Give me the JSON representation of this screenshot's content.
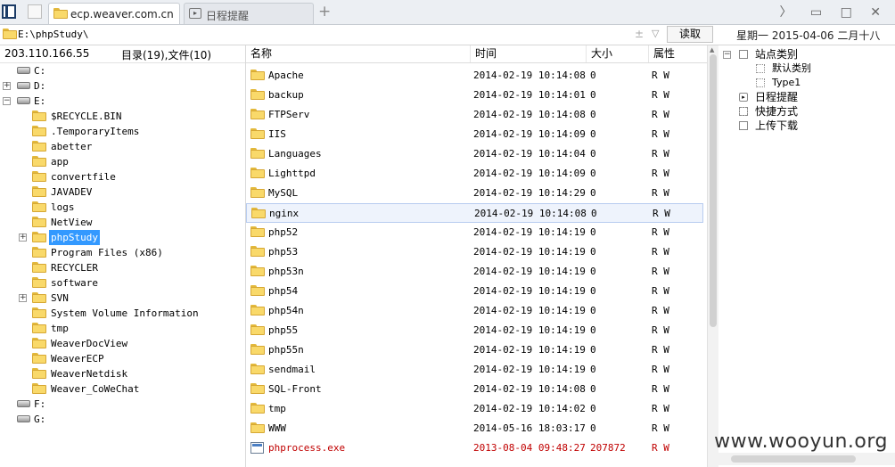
{
  "tabs": [
    {
      "label": "ecp.weaver.com.cn",
      "active": true
    },
    {
      "label": "日程提醒",
      "active": false
    }
  ],
  "tab_new": "+",
  "window_controls": "〉 ▭ □ ✕",
  "address": {
    "path": "E:\\phpStudy\\",
    "plusminus": "± ",
    "read_button": "读取"
  },
  "date_line": "星期一  2015-04-06  二月十八",
  "left_panel": {
    "ip": "203.110.166.55",
    "dir_count": "目录(19),文件(10)",
    "tree": [
      {
        "label": "C:",
        "type": "drive",
        "depth": 0,
        "expander": ""
      },
      {
        "label": "D:",
        "type": "drive",
        "depth": 0,
        "expander": "+"
      },
      {
        "label": "E:",
        "type": "drive",
        "depth": 0,
        "expander": "−"
      },
      {
        "label": "$RECYCLE.BIN",
        "type": "folder",
        "depth": 1,
        "expander": ""
      },
      {
        "label": ".TemporaryItems",
        "type": "folder",
        "depth": 1,
        "expander": ""
      },
      {
        "label": "abetter",
        "type": "folder",
        "depth": 1,
        "expander": ""
      },
      {
        "label": "app",
        "type": "folder",
        "depth": 1,
        "expander": ""
      },
      {
        "label": "convertfile",
        "type": "folder",
        "depth": 1,
        "expander": ""
      },
      {
        "label": "JAVADEV",
        "type": "folder",
        "depth": 1,
        "expander": ""
      },
      {
        "label": "logs",
        "type": "folder",
        "depth": 1,
        "expander": ""
      },
      {
        "label": "NetView",
        "type": "folder",
        "depth": 1,
        "expander": ""
      },
      {
        "label": "phpStudy",
        "type": "folder",
        "depth": 1,
        "expander": "+",
        "selected": true
      },
      {
        "label": "Program Files (x86)",
        "type": "folder",
        "depth": 1,
        "expander": ""
      },
      {
        "label": "RECYCLER",
        "type": "folder",
        "depth": 1,
        "expander": ""
      },
      {
        "label": "software",
        "type": "folder",
        "depth": 1,
        "expander": ""
      },
      {
        "label": "SVN",
        "type": "folder",
        "depth": 1,
        "expander": "+"
      },
      {
        "label": "System Volume Information",
        "type": "folder",
        "depth": 1,
        "expander": ""
      },
      {
        "label": "tmp",
        "type": "folder",
        "depth": 1,
        "expander": ""
      },
      {
        "label": "WeaverDocView",
        "type": "folder",
        "depth": 1,
        "expander": ""
      },
      {
        "label": "WeaverECP",
        "type": "folder",
        "depth": 1,
        "expander": ""
      },
      {
        "label": "WeaverNetdisk",
        "type": "folder",
        "depth": 1,
        "expander": ""
      },
      {
        "label": "Weaver_CoWeChat",
        "type": "folder",
        "depth": 1,
        "expander": ""
      },
      {
        "label": "F:",
        "type": "drive",
        "depth": 0,
        "expander": ""
      },
      {
        "label": "G:",
        "type": "drive",
        "depth": 0,
        "expander": ""
      }
    ]
  },
  "file_list": {
    "headers": {
      "name": "名称",
      "time": "时间",
      "size": "大小",
      "attr": "属性"
    },
    "rows": [
      {
        "name": "Apache",
        "time": "2014-02-19 10:14:08",
        "size": "0",
        "attr": "R W",
        "type": "folder"
      },
      {
        "name": "backup",
        "time": "2014-02-19 10:14:01",
        "size": "0",
        "attr": "R W",
        "type": "folder"
      },
      {
        "name": "FTPServ",
        "time": "2014-02-19 10:14:08",
        "size": "0",
        "attr": "R W",
        "type": "folder"
      },
      {
        "name": "IIS",
        "time": "2014-02-19 10:14:09",
        "size": "0",
        "attr": "R W",
        "type": "folder"
      },
      {
        "name": "Languages",
        "time": "2014-02-19 10:14:04",
        "size": "0",
        "attr": "R W",
        "type": "folder"
      },
      {
        "name": "Lighttpd",
        "time": "2014-02-19 10:14:09",
        "size": "0",
        "attr": "R W",
        "type": "folder"
      },
      {
        "name": "MySQL",
        "time": "2014-02-19 10:14:29",
        "size": "0",
        "attr": "R W",
        "type": "folder"
      },
      {
        "name": "nginx",
        "time": "2014-02-19 10:14:08",
        "size": "0",
        "attr": "R W",
        "type": "folder",
        "highlighted": true
      },
      {
        "name": "php52",
        "time": "2014-02-19 10:14:19",
        "size": "0",
        "attr": "R W",
        "type": "folder"
      },
      {
        "name": "php53",
        "time": "2014-02-19 10:14:19",
        "size": "0",
        "attr": "R W",
        "type": "folder"
      },
      {
        "name": "php53n",
        "time": "2014-02-19 10:14:19",
        "size": "0",
        "attr": "R W",
        "type": "folder"
      },
      {
        "name": "php54",
        "time": "2014-02-19 10:14:19",
        "size": "0",
        "attr": "R W",
        "type": "folder"
      },
      {
        "name": "php54n",
        "time": "2014-02-19 10:14:19",
        "size": "0",
        "attr": "R W",
        "type": "folder"
      },
      {
        "name": "php55",
        "time": "2014-02-19 10:14:19",
        "size": "0",
        "attr": "R W",
        "type": "folder"
      },
      {
        "name": "php55n",
        "time": "2014-02-19 10:14:19",
        "size": "0",
        "attr": "R W",
        "type": "folder"
      },
      {
        "name": "sendmail",
        "time": "2014-02-19 10:14:19",
        "size": "0",
        "attr": "R W",
        "type": "folder"
      },
      {
        "name": "SQL-Front",
        "time": "2014-02-19 10:14:08",
        "size": "0",
        "attr": "R W",
        "type": "folder"
      },
      {
        "name": "tmp",
        "time": "2014-02-19 10:14:02",
        "size": "0",
        "attr": "R W",
        "type": "folder"
      },
      {
        "name": "WWW",
        "time": "2014-05-16 18:03:17",
        "size": "0",
        "attr": "R W",
        "type": "folder"
      },
      {
        "name": "phprocess.exe",
        "time": "2013-08-04 09:48:27",
        "size": "207872",
        "attr": "R W",
        "type": "exe",
        "red": true
      }
    ]
  },
  "right_panel": {
    "items": [
      {
        "label": "站点类别",
        "expander": "−",
        "depth": 0,
        "icon": "box"
      },
      {
        "label": "默认类别",
        "expander": "",
        "depth": 1,
        "icon": "dot"
      },
      {
        "label": "Type1",
        "expander": "",
        "depth": 1,
        "icon": "dot"
      },
      {
        "label": "日程提醒",
        "expander": "",
        "depth": 0,
        "icon": "schedule"
      },
      {
        "label": "快捷方式",
        "expander": "",
        "depth": 0,
        "icon": "shortcut"
      },
      {
        "label": "上传下载",
        "expander": "",
        "depth": 0,
        "icon": "box"
      }
    ]
  },
  "watermark": "www.wooyun.org",
  "colors": {
    "selection": "#3399ff",
    "highlight_row": "#eef3fc",
    "exe_text": "#c00000",
    "folder": "#f9d96a"
  }
}
